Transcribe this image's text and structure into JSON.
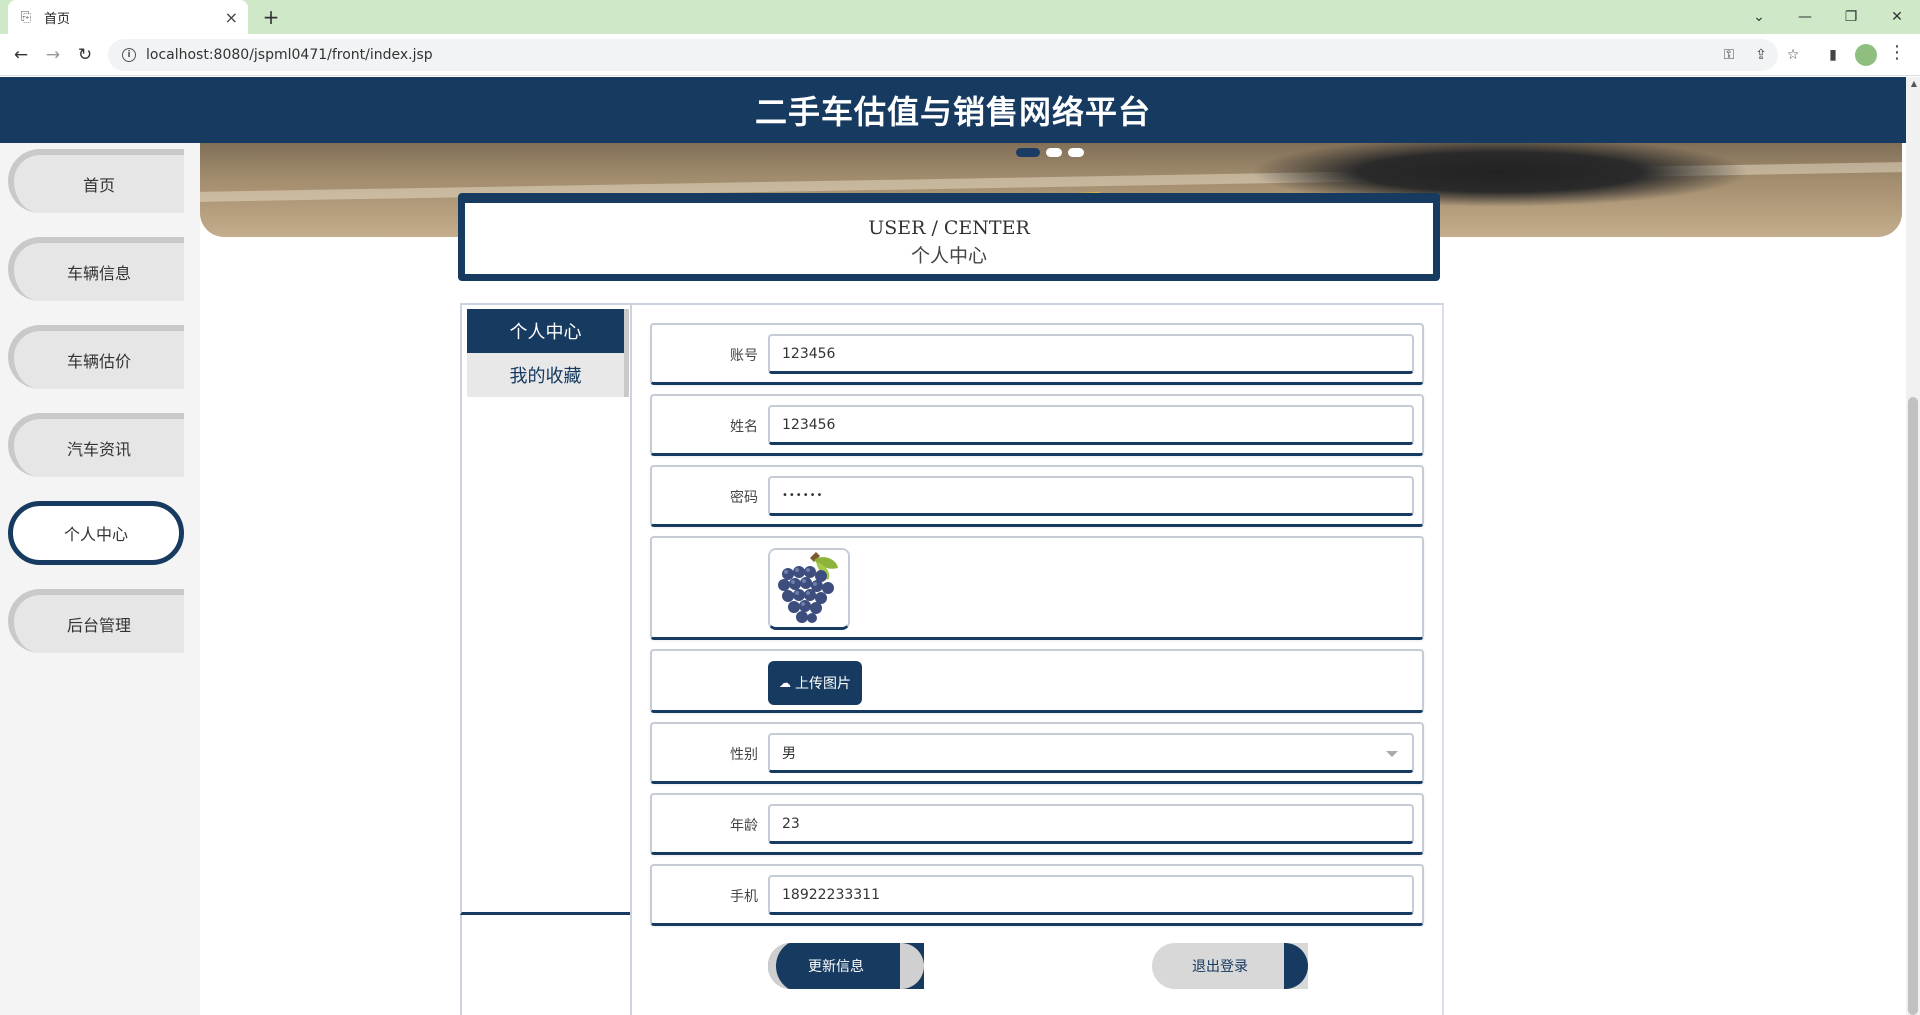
{
  "browser": {
    "tab_title": "首页",
    "url": "localhost:8080/jspml0471/front/index.jsp"
  },
  "header": {
    "title": "二手车估值与销售网络平台"
  },
  "sidebar": {
    "items": [
      {
        "label": "首页",
        "active": false
      },
      {
        "label": "车辆信息",
        "active": false
      },
      {
        "label": "车辆估价",
        "active": false
      },
      {
        "label": "汽车资讯",
        "active": false
      },
      {
        "label": "个人中心",
        "active": true
      },
      {
        "label": "后台管理",
        "active": false
      }
    ]
  },
  "banner": {
    "slides": 3,
    "active_slide": 1
  },
  "user_center": {
    "title_en": "USER / CENTER",
    "title_cn": "个人中心"
  },
  "panel_tabs": [
    {
      "label": "个人中心",
      "active": true
    },
    {
      "label": "我的收藏",
      "active": false
    }
  ],
  "form": {
    "account": {
      "label": "账号",
      "value": "123456"
    },
    "name": {
      "label": "姓名",
      "value": "123456"
    },
    "password": {
      "label": "密码",
      "value": "••••••"
    },
    "upload_label": "上传图片",
    "gender": {
      "label": "性别",
      "value": "男"
    },
    "age": {
      "label": "年龄",
      "value": "23"
    },
    "phone": {
      "label": "手机",
      "value": "18922233311"
    }
  },
  "actions": {
    "update": "更新信息",
    "logout": "退出登录"
  },
  "colors": {
    "primary": "#163a60",
    "sidebar_bg": "#f4f4f4",
    "tab_bar": "#cfe8c8"
  }
}
